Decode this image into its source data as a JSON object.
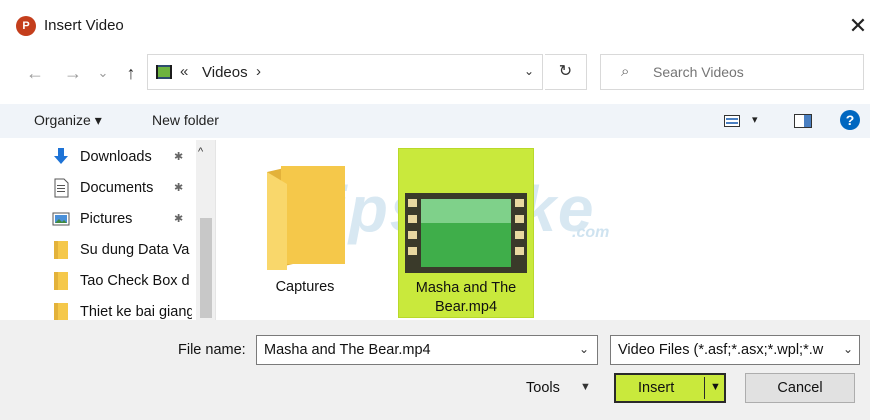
{
  "window": {
    "app_icon_letter": "P",
    "title": "Insert Video",
    "close_glyph": "✕"
  },
  "nav": {
    "back_glyph": "←",
    "forward_glyph": "→",
    "recent_glyph": "⌄",
    "up_glyph": "↑",
    "address_prefix": "«",
    "address_crumb": "Videos",
    "address_sep": "›",
    "address_dropdown": "⌄",
    "refresh_glyph": "↻",
    "search_glyph": "⌕",
    "search_placeholder": "Search Videos"
  },
  "toolbar": {
    "organize_label": "Organize ▾",
    "new_folder_label": "New folder",
    "view_arrow": "▾",
    "help_glyph": "?"
  },
  "sidebar": {
    "items": [
      {
        "label": "Downloads",
        "icon": "download-arrow-icon",
        "pinned": true
      },
      {
        "label": "Documents",
        "icon": "document-icon",
        "pinned": true
      },
      {
        "label": "Pictures",
        "icon": "pictures-icon",
        "pinned": true
      },
      {
        "label": "Su dung Data Va",
        "icon": "folder-icon",
        "pinned": false
      },
      {
        "label": "Tao Check Box d",
        "icon": "folder-icon",
        "pinned": false
      },
      {
        "label": "Thiet ke bai giang",
        "icon": "folder-icon",
        "pinned": false
      }
    ],
    "pin_glyph": "✱",
    "scroll_up_glyph": "^"
  },
  "files": [
    {
      "name": "Captures",
      "kind": "folder",
      "selected": false
    },
    {
      "name": "Masha and The Bear.mp4",
      "kind": "video",
      "selected": true
    }
  ],
  "watermark": {
    "text": "TipsMake",
    "suffix": ".com"
  },
  "footer": {
    "file_name_label": "File name:",
    "file_name_value": "Masha and The Bear.mp4",
    "file_type_value": "Video Files (*.asf;*.asx;*.wpl;*.w",
    "dropdown_glyph": "⌄",
    "tools_label": "Tools",
    "tools_arrow": "▼",
    "insert_label": "Insert",
    "insert_arrow": "▼",
    "cancel_label": "Cancel"
  },
  "colors": {
    "selection": "#c9e93c",
    "accent": "#0067c0",
    "folder": "#f5c84a",
    "powerpoint": "#c43e1c"
  }
}
